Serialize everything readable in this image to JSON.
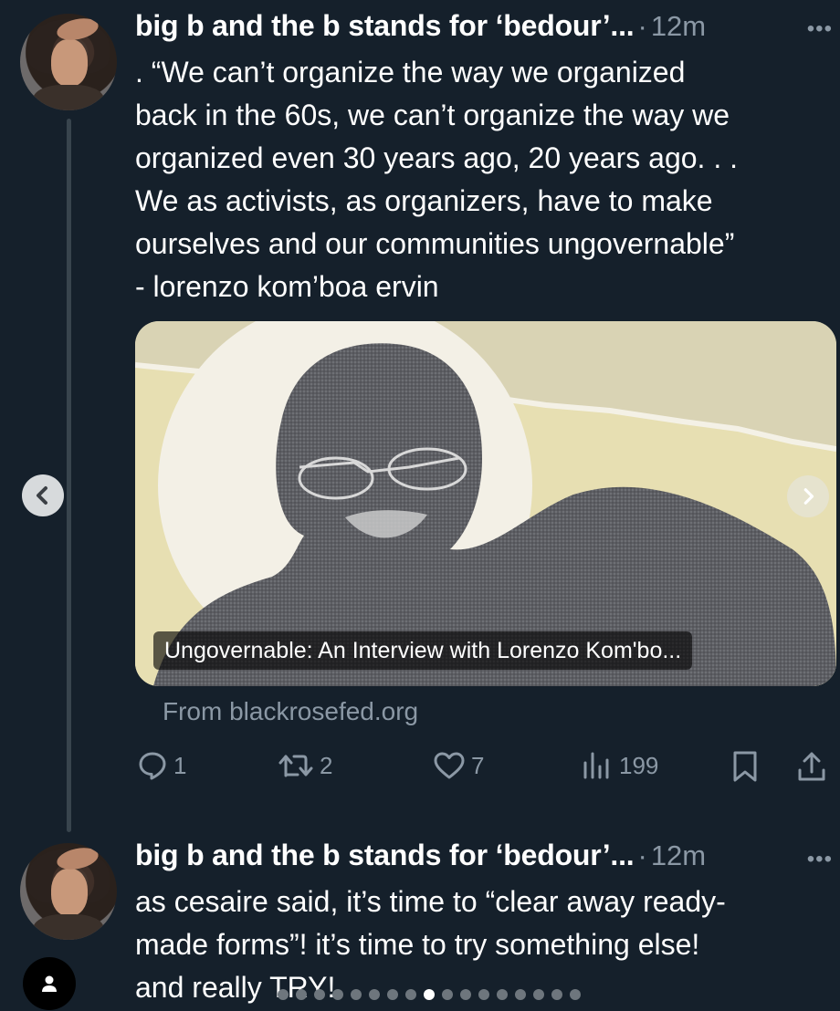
{
  "tweets": [
    {
      "author": "big b and the b stands for ‘bedour’...",
      "separator": "·",
      "time": "12m",
      "more": "•••",
      "text_lines": [
        ". “We can’t organize the way we organized",
        "back in the 60s, we can’t organize the way we",
        "organized even 30 years ago, 20 years ago. . .",
        "We as activists, as organizers, have to make",
        "ourselves and our communities ungovernable”",
        "- lorenzo kom’boa ervin"
      ],
      "link_card": {
        "title": "Ungovernable: An Interview with Lorenzo Kom'bo...",
        "source": "From blackrosefed.org"
      },
      "stats": {
        "replies": "1",
        "retweets": "2",
        "likes": "7",
        "views": "199"
      }
    },
    {
      "author": "big b and the b stands for ‘bedour’...",
      "separator": "·",
      "time": "12m",
      "more": "•••",
      "text_lines": [
        "as cesaire said, it’s time to “clear away ready-",
        "made forms”! it’s time to try something else!",
        "and really TRY!"
      ]
    }
  ],
  "colors": {
    "background": "#15202b",
    "text": "#ffffff",
    "muted": "#8b98a5",
    "thread_line": "#38444d"
  },
  "icons": [
    "reply-icon",
    "retweet-icon",
    "heart-icon",
    "views-icon",
    "bookmark-icon",
    "share-icon",
    "chevron-left-icon",
    "chevron-right-icon",
    "profile-icon"
  ],
  "carousel": {
    "total_dots": 17,
    "active_index": 8
  }
}
